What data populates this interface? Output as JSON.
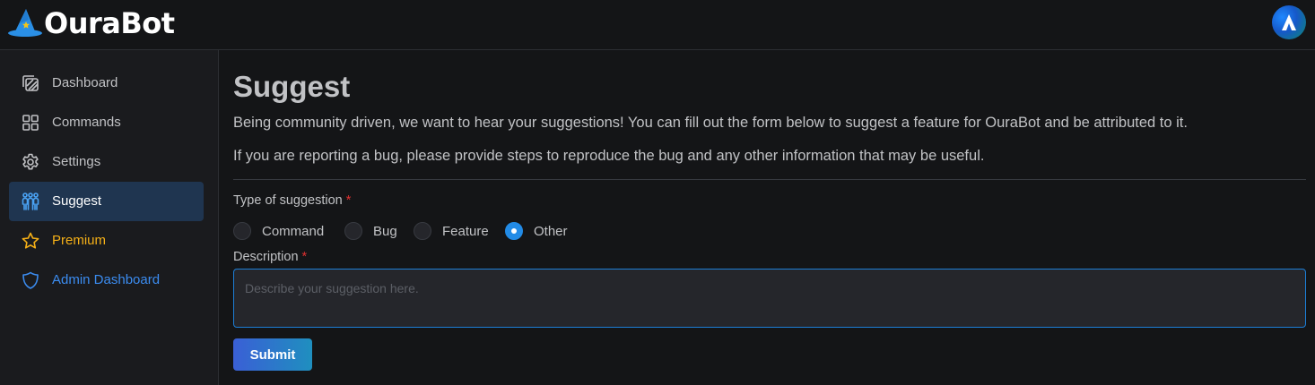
{
  "app": {
    "name": "OuraBot"
  },
  "sidebar": {
    "items": [
      {
        "label": "Dashboard",
        "icon": "dashboard-icon"
      },
      {
        "label": "Commands",
        "icon": "grid-icon"
      },
      {
        "label": "Settings",
        "icon": "gear-icon"
      },
      {
        "label": "Suggest",
        "icon": "users-icon",
        "active": true
      },
      {
        "label": "Premium",
        "icon": "star-icon",
        "color": "#f5b017"
      },
      {
        "label": "Admin Dashboard",
        "icon": "shield-icon",
        "color": "#3b8cf0"
      }
    ]
  },
  "page": {
    "title": "Suggest",
    "paragraph1": "Being community driven, we want to hear your suggestions! You can fill out the form below to suggest a feature for OuraBot and be attributed to it.",
    "paragraph2": "If you are reporting a bug, please provide steps to reproduce the bug and any other information that may be useful."
  },
  "form": {
    "type_label": "Type of suggestion",
    "required_mark": "*",
    "options": [
      "Command",
      "Bug",
      "Feature",
      "Other"
    ],
    "selected": "Other",
    "description_label": "Description",
    "description_placeholder": "Describe your suggestion here.",
    "description_value": "",
    "submit_label": "Submit"
  },
  "colors": {
    "accent": "#228be6",
    "premium": "#f5b017",
    "admin": "#3b8cf0",
    "required": "#e03131",
    "active_bg": "#1f3550"
  }
}
